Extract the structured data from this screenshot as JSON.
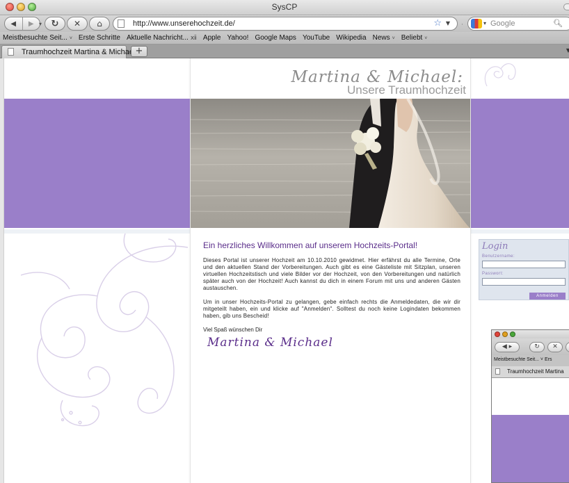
{
  "window": {
    "title": "SysCP"
  },
  "toolbar": {
    "back_icon": "back-arrow-icon",
    "forward_icon": "forward-arrow-icon",
    "reload_icon": "reload-icon",
    "stop_icon": "stop-icon",
    "home_icon": "home-icon",
    "url": "http://www.unserehochzeit.de/",
    "search_placeholder": "Google"
  },
  "bookmarks": [
    {
      "label": "Meistbesuchte Seit...",
      "dropdown": true
    },
    {
      "label": "Erste Schritte",
      "dropdown": false
    },
    {
      "label": "Aktuelle Nachricht...",
      "dropdown": false,
      "rss": true
    },
    {
      "label": "Apple",
      "dropdown": false
    },
    {
      "label": "Yahoo!",
      "dropdown": false
    },
    {
      "label": "Google Maps",
      "dropdown": false
    },
    {
      "label": "YouTube",
      "dropdown": false
    },
    {
      "label": "Wikipedia",
      "dropdown": false
    },
    {
      "label": "News",
      "dropdown": true
    },
    {
      "label": "Beliebt",
      "dropdown": true
    }
  ],
  "tabs": [
    {
      "label": "Traumhochzeit Martina & Michael"
    }
  ],
  "page": {
    "brand_script": "Martina & Michael:",
    "brand_subtitle": "Unsere Traumhochzeit",
    "welcome_heading": "Ein herzliches Willkommen auf unserem Hochzeits-Portal!",
    "paragraph_1": "Dieses Portal ist unserer Hochzeit am 10.10.2010 gewidmet. Hier erfährst du alle Termine, Orte und den aktuellen Stand der Vorbereitungen. Auch gibt es eine Gästeliste mit Sitzplan, unseren virtuellen Hochzeitstisch und viele Bilder vor der Hochzeit, von den Vorbereitungen und natürlich später auch von der Hochzeit! Auch kannst du dich in einem Forum mit uns und anderen Gästen austauschen.",
    "paragraph_2": "Um in unser Hochzeits-Portal zu gelangen, gebe einfach rechts die Anmeldedaten, die wir dir mitgeteilt haben, ein und klicke auf \"Anmelden\". Solltest du noch keine Logindaten bekommen haben, gib uns Bescheid!",
    "greeting": "Viel Spaß wünschen Dir",
    "signature": "Martina & Michael"
  },
  "login": {
    "title": "Login",
    "username_label": "Benutzername:",
    "password_label": "Passwort:",
    "button_label": "Anmelden"
  },
  "nested_window": {
    "bookmarks_text": "Meistbesuchte Seit... ˅  Ers",
    "tab_label": "Traumhochzeit Martina"
  },
  "colors": {
    "purple": "#9a7fc9",
    "heading_purple": "#5a2d8a",
    "login_bg": "#dfe5ee"
  }
}
